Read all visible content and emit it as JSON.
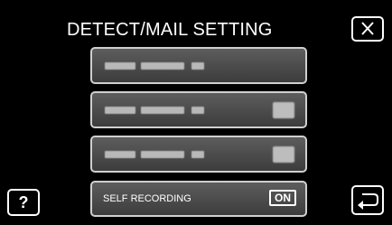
{
  "header": {
    "title": "DETECT/MAIL SETTING",
    "close_icon": "close-x-icon"
  },
  "menu": {
    "items": [
      {
        "label": "",
        "state": ""
      },
      {
        "label": "",
        "state": ""
      },
      {
        "label": "",
        "state": ""
      },
      {
        "label": "SELF RECORDING",
        "state": "ON"
      }
    ]
  },
  "footer": {
    "help_label": "?",
    "back_icon": "return-arrow-icon"
  }
}
